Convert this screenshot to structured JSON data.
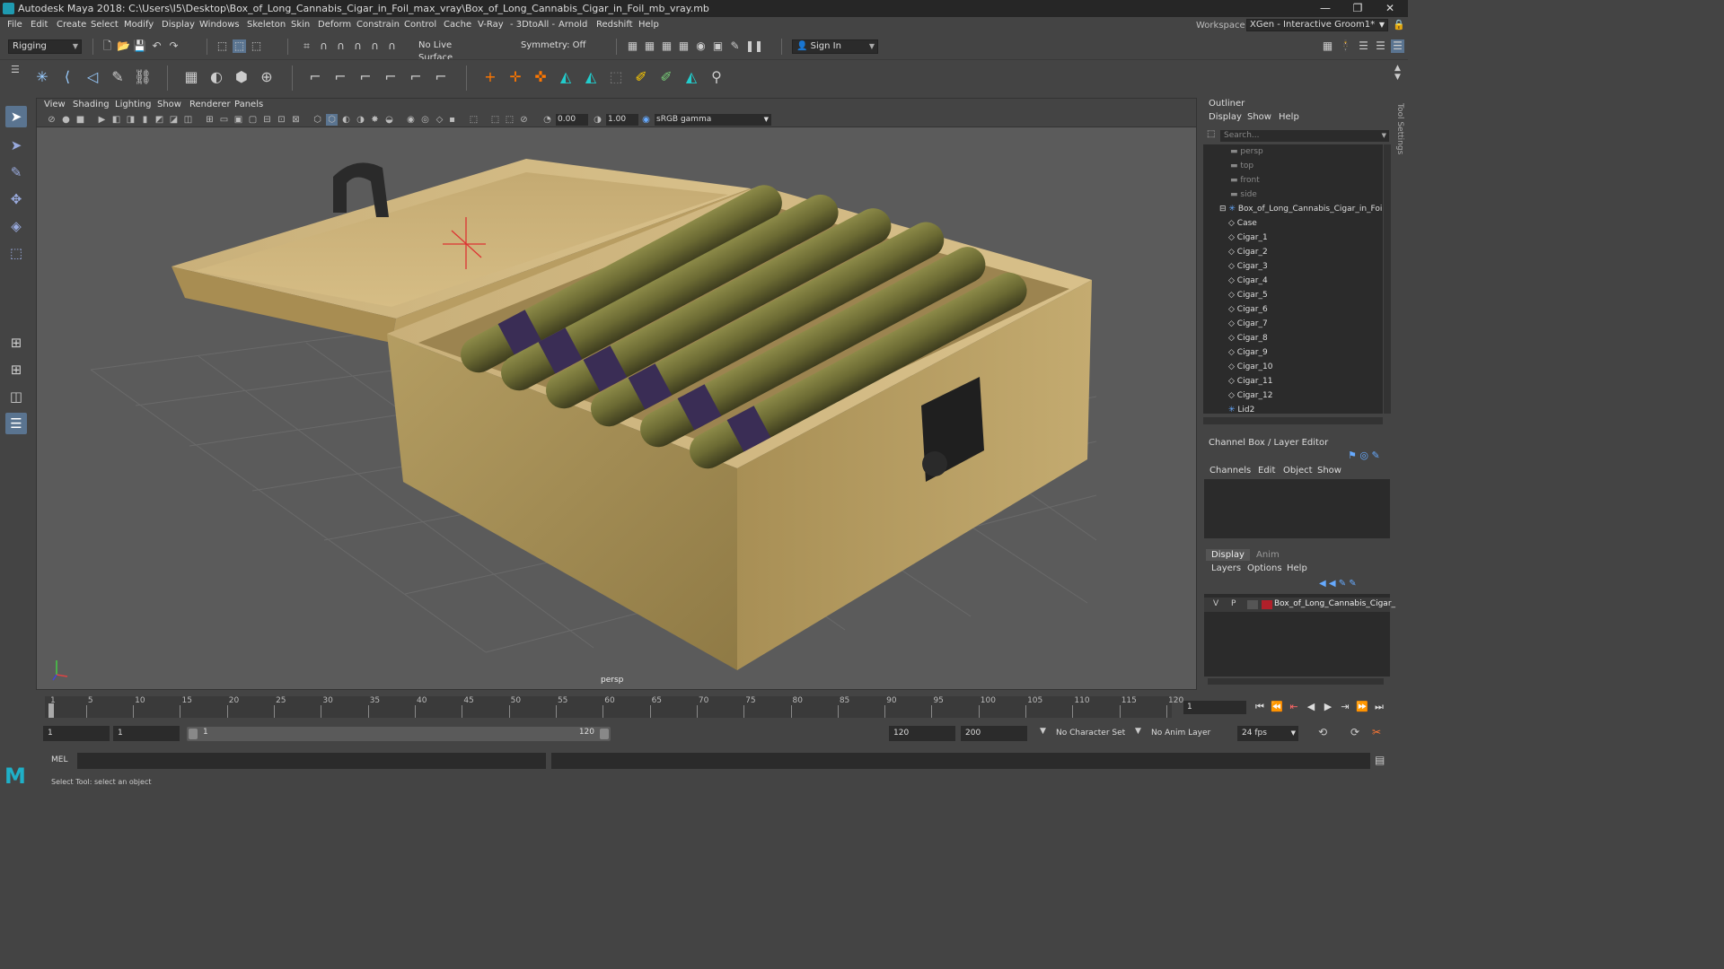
{
  "window": {
    "title": "Autodesk Maya 2018: C:\\Users\\I5\\Desktop\\Box_of_Long_Cannabis_Cigar_in_Foil_max_vray\\Box_of_Long_Cannabis_Cigar_in_Foil_mb_vray.mb",
    "minimize": "—",
    "restore": "❐",
    "close": "✕"
  },
  "menu": [
    "File",
    "Edit",
    "Create",
    "Select",
    "Modify",
    "Display",
    "Windows",
    "Skeleton",
    "Skin",
    "Deform",
    "Constrain",
    "Control",
    "Cache",
    "V-Ray",
    "- 3DtoAll -",
    "Arnold",
    "Redshift",
    "Help"
  ],
  "workspace": {
    "label": "Workspace :",
    "value": "XGen - Interactive Groom1*"
  },
  "status": {
    "mode": "Rigging",
    "live_surface": "No Live Surface",
    "symmetry": "Symmetry: Off",
    "sign_in": "Sign In"
  },
  "viewport": {
    "menu": [
      "View",
      "Shading",
      "Lighting",
      "Show",
      "Renderer",
      "Panels"
    ],
    "exposure": "0.00",
    "gamma": "1.00",
    "color_space": "sRGB gamma",
    "camera_label": "persp"
  },
  "outliner": {
    "title": "Outliner",
    "menu": [
      "Display",
      "Show",
      "Help"
    ],
    "search_placeholder": "Search...",
    "items": [
      {
        "label": "persp",
        "type": "camera"
      },
      {
        "label": "top",
        "type": "camera"
      },
      {
        "label": "front",
        "type": "camera"
      },
      {
        "label": "side",
        "type": "camera"
      },
      {
        "label": "Box_of_Long_Cannabis_Cigar_in_Foil",
        "type": "group"
      },
      {
        "label": "Case",
        "type": "mesh"
      },
      {
        "label": "Cigar_1",
        "type": "mesh"
      },
      {
        "label": "Cigar_2",
        "type": "mesh"
      },
      {
        "label": "Cigar_3",
        "type": "mesh"
      },
      {
        "label": "Cigar_4",
        "type": "mesh"
      },
      {
        "label": "Cigar_5",
        "type": "mesh"
      },
      {
        "label": "Cigar_6",
        "type": "mesh"
      },
      {
        "label": "Cigar_7",
        "type": "mesh"
      },
      {
        "label": "Cigar_8",
        "type": "mesh"
      },
      {
        "label": "Cigar_9",
        "type": "mesh"
      },
      {
        "label": "Cigar_10",
        "type": "mesh"
      },
      {
        "label": "Cigar_11",
        "type": "mesh"
      },
      {
        "label": "Cigar_12",
        "type": "mesh"
      },
      {
        "label": "Lid2",
        "type": "group"
      }
    ]
  },
  "channelbox": {
    "title": "Channel Box / Layer Editor",
    "menu": [
      "Channels",
      "Edit",
      "Object",
      "Show"
    ]
  },
  "layers": {
    "tabs": [
      "Display",
      "Anim"
    ],
    "menu": [
      "Layers",
      "Options",
      "Help"
    ],
    "row": {
      "v": "V",
      "p": "P",
      "name": "Box_of_Long_Cannabis_Cigar_",
      "color": "#b0202a"
    }
  },
  "timeline": {
    "ticks": [
      "1",
      "5",
      "10",
      "15",
      "20",
      "25",
      "30",
      "35",
      "40",
      "45",
      "50",
      "55",
      "60",
      "65",
      "70",
      "75",
      "80",
      "85",
      "90",
      "95",
      "100",
      "105",
      "110",
      "115",
      "120"
    ],
    "current_frame": "1"
  },
  "range": {
    "start": "1",
    "playback_start": "1",
    "range_start": "1",
    "range_end": "120",
    "playback_end": "120",
    "end": "200",
    "character_set": "No Character Set",
    "anim_layer": "No Anim Layer",
    "fps": "24 fps"
  },
  "cmdline": {
    "label": "MEL"
  },
  "helpline": {
    "text": "Select Tool: select an object"
  },
  "toolsettings_tab": "Tool Settings"
}
